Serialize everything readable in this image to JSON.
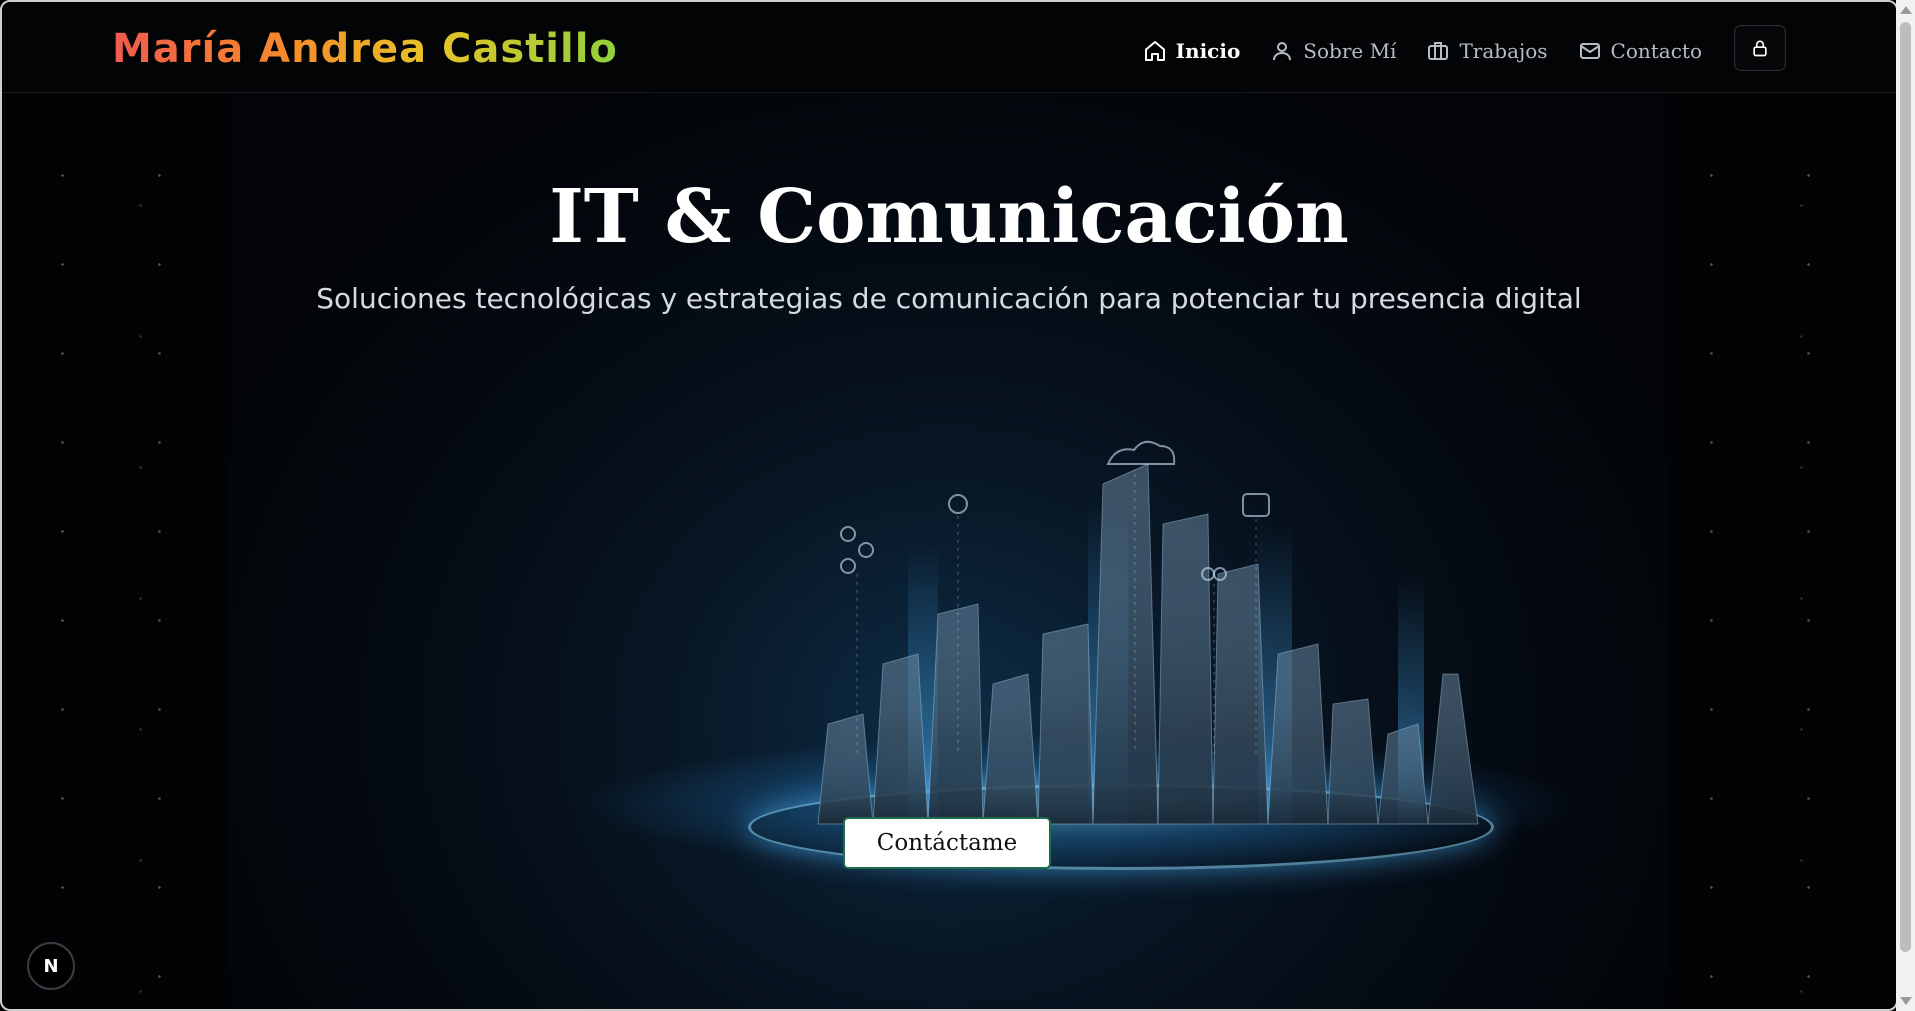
{
  "header": {
    "logo": "María Andrea Castillo",
    "nav": [
      {
        "label": "Inicio",
        "icon": "home-icon",
        "active": true
      },
      {
        "label": "Sobre Mí",
        "icon": "user-icon",
        "active": false
      },
      {
        "label": "Trabajos",
        "icon": "briefcase-icon",
        "active": false
      },
      {
        "label": "Contacto",
        "icon": "mail-icon",
        "active": false
      }
    ],
    "lock_icon": "lock-icon"
  },
  "hero": {
    "title": "IT & Comunicación",
    "subtitle": "Soluciones tecnológicas y estrategias de comunicación para potenciar tu presencia digital",
    "cta_label": "Contáctame"
  },
  "badge": {
    "label": "N"
  },
  "colors": {
    "logo_gradient": [
      "#f25a4e",
      "#f58a2a",
      "#e9c227",
      "#8fd13c"
    ],
    "background": "#020305",
    "cta_border": "#1c6b4a"
  }
}
